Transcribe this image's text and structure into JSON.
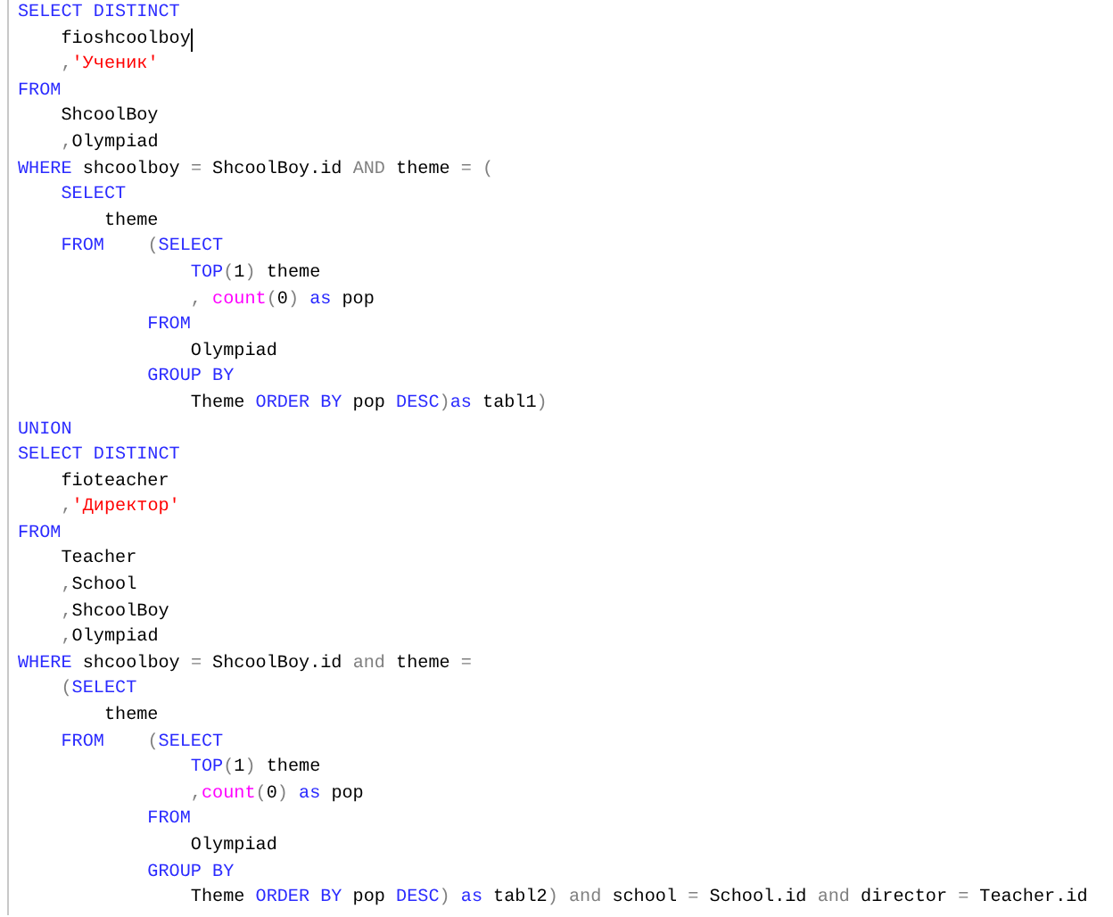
{
  "editor": {
    "lines": [
      {
        "cursor": false,
        "tokens": [
          {
            "kind": "keyword",
            "text": "SELECT DISTINCT"
          }
        ]
      },
      {
        "cursor": true,
        "tokens": [
          {
            "kind": "plain",
            "text": "    fioshcoolboy"
          }
        ]
      },
      {
        "cursor": false,
        "tokens": [
          {
            "kind": "operator",
            "text": "    ,"
          },
          {
            "kind": "string",
            "text": "'Ученик'"
          }
        ]
      },
      {
        "cursor": false,
        "tokens": [
          {
            "kind": "keyword",
            "text": "FROM"
          }
        ]
      },
      {
        "cursor": false,
        "tokens": [
          {
            "kind": "plain",
            "text": "    ShcoolBoy"
          }
        ]
      },
      {
        "cursor": false,
        "tokens": [
          {
            "kind": "operator",
            "text": "    ,"
          },
          {
            "kind": "plain",
            "text": "Olympiad"
          }
        ]
      },
      {
        "cursor": false,
        "tokens": [
          {
            "kind": "keyword",
            "text": "WHERE"
          },
          {
            "kind": "plain",
            "text": " shcoolboy "
          },
          {
            "kind": "operator",
            "text": "="
          },
          {
            "kind": "plain",
            "text": " ShcoolBoy.id "
          },
          {
            "kind": "operator",
            "text": "AND"
          },
          {
            "kind": "plain",
            "text": " theme "
          },
          {
            "kind": "operator",
            "text": "= ("
          }
        ]
      },
      {
        "cursor": false,
        "tokens": [
          {
            "kind": "keyword",
            "text": "    SELECT"
          }
        ]
      },
      {
        "cursor": false,
        "tokens": [
          {
            "kind": "plain",
            "text": "        theme"
          }
        ]
      },
      {
        "cursor": false,
        "tokens": [
          {
            "kind": "keyword",
            "text": "    FROM"
          },
          {
            "kind": "operator",
            "text": "    ("
          },
          {
            "kind": "keyword",
            "text": "SELECT"
          }
        ]
      },
      {
        "cursor": false,
        "tokens": [
          {
            "kind": "keyword",
            "text": "                TOP"
          },
          {
            "kind": "operator",
            "text": "("
          },
          {
            "kind": "plain",
            "text": "1"
          },
          {
            "kind": "operator",
            "text": ")"
          },
          {
            "kind": "plain",
            "text": " theme"
          }
        ]
      },
      {
        "cursor": false,
        "tokens": [
          {
            "kind": "operator",
            "text": "                , "
          },
          {
            "kind": "function",
            "text": "count"
          },
          {
            "kind": "operator",
            "text": "("
          },
          {
            "kind": "plain",
            "text": "0"
          },
          {
            "kind": "operator",
            "text": ")"
          },
          {
            "kind": "keyword",
            "text": " as"
          },
          {
            "kind": "plain",
            "text": " pop"
          }
        ]
      },
      {
        "cursor": false,
        "tokens": [
          {
            "kind": "keyword",
            "text": "            FROM"
          }
        ]
      },
      {
        "cursor": false,
        "tokens": [
          {
            "kind": "plain",
            "text": "                Olympiad"
          }
        ]
      },
      {
        "cursor": false,
        "tokens": [
          {
            "kind": "keyword",
            "text": "            GROUP BY"
          }
        ]
      },
      {
        "cursor": false,
        "tokens": [
          {
            "kind": "plain",
            "text": "                Theme "
          },
          {
            "kind": "keyword",
            "text": "ORDER BY"
          },
          {
            "kind": "plain",
            "text": " pop "
          },
          {
            "kind": "keyword",
            "text": "DESC"
          },
          {
            "kind": "operator",
            "text": ")"
          },
          {
            "kind": "keyword",
            "text": "as"
          },
          {
            "kind": "plain",
            "text": " tabl1"
          },
          {
            "kind": "operator",
            "text": ")"
          }
        ]
      },
      {
        "cursor": false,
        "tokens": [
          {
            "kind": "keyword",
            "text": "UNION"
          }
        ]
      },
      {
        "cursor": false,
        "tokens": [
          {
            "kind": "keyword",
            "text": "SELECT DISTINCT"
          }
        ]
      },
      {
        "cursor": false,
        "tokens": [
          {
            "kind": "plain",
            "text": "    fioteacher"
          }
        ]
      },
      {
        "cursor": false,
        "tokens": [
          {
            "kind": "operator",
            "text": "    ,"
          },
          {
            "kind": "string",
            "text": "'Директор'"
          }
        ]
      },
      {
        "cursor": false,
        "tokens": [
          {
            "kind": "keyword",
            "text": "FROM"
          }
        ]
      },
      {
        "cursor": false,
        "tokens": [
          {
            "kind": "plain",
            "text": "    Teacher"
          }
        ]
      },
      {
        "cursor": false,
        "tokens": [
          {
            "kind": "operator",
            "text": "    ,"
          },
          {
            "kind": "plain",
            "text": "School"
          }
        ]
      },
      {
        "cursor": false,
        "tokens": [
          {
            "kind": "operator",
            "text": "    ,"
          },
          {
            "kind": "plain",
            "text": "ShcoolBoy"
          }
        ]
      },
      {
        "cursor": false,
        "tokens": [
          {
            "kind": "operator",
            "text": "    ,"
          },
          {
            "kind": "plain",
            "text": "Olympiad"
          }
        ]
      },
      {
        "cursor": false,
        "tokens": [
          {
            "kind": "keyword",
            "text": "WHERE"
          },
          {
            "kind": "plain",
            "text": " shcoolboy "
          },
          {
            "kind": "operator",
            "text": "="
          },
          {
            "kind": "plain",
            "text": " ShcoolBoy.id "
          },
          {
            "kind": "operator",
            "text": "and"
          },
          {
            "kind": "plain",
            "text": " theme "
          },
          {
            "kind": "operator",
            "text": "="
          }
        ]
      },
      {
        "cursor": false,
        "tokens": [
          {
            "kind": "operator",
            "text": "    ("
          },
          {
            "kind": "keyword",
            "text": "SELECT"
          }
        ]
      },
      {
        "cursor": false,
        "tokens": [
          {
            "kind": "plain",
            "text": "        theme"
          }
        ]
      },
      {
        "cursor": false,
        "tokens": [
          {
            "kind": "keyword",
            "text": "    FROM"
          },
          {
            "kind": "operator",
            "text": "    ("
          },
          {
            "kind": "keyword",
            "text": "SELECT"
          }
        ]
      },
      {
        "cursor": false,
        "tokens": [
          {
            "kind": "keyword",
            "text": "                TOP"
          },
          {
            "kind": "operator",
            "text": "("
          },
          {
            "kind": "plain",
            "text": "1"
          },
          {
            "kind": "operator",
            "text": ")"
          },
          {
            "kind": "plain",
            "text": " theme"
          }
        ]
      },
      {
        "cursor": false,
        "tokens": [
          {
            "kind": "operator",
            "text": "                ,"
          },
          {
            "kind": "function",
            "text": "count"
          },
          {
            "kind": "operator",
            "text": "("
          },
          {
            "kind": "plain",
            "text": "0"
          },
          {
            "kind": "operator",
            "text": ")"
          },
          {
            "kind": "keyword",
            "text": " as"
          },
          {
            "kind": "plain",
            "text": " pop"
          }
        ]
      },
      {
        "cursor": false,
        "tokens": [
          {
            "kind": "keyword",
            "text": "            FROM"
          }
        ]
      },
      {
        "cursor": false,
        "tokens": [
          {
            "kind": "plain",
            "text": "                Olympiad"
          }
        ]
      },
      {
        "cursor": false,
        "tokens": [
          {
            "kind": "keyword",
            "text": "            GROUP BY"
          }
        ]
      },
      {
        "cursor": false,
        "tokens": [
          {
            "kind": "plain",
            "text": "                Theme "
          },
          {
            "kind": "keyword",
            "text": "ORDER BY"
          },
          {
            "kind": "plain",
            "text": " pop "
          },
          {
            "kind": "keyword",
            "text": "DESC"
          },
          {
            "kind": "operator",
            "text": ")"
          },
          {
            "kind": "keyword",
            "text": " as"
          },
          {
            "kind": "plain",
            "text": " tabl2"
          },
          {
            "kind": "operator",
            "text": ")"
          },
          {
            "kind": "operator",
            "text": " and"
          },
          {
            "kind": "plain",
            "text": " school "
          },
          {
            "kind": "operator",
            "text": "="
          },
          {
            "kind": "plain",
            "text": " School.id "
          },
          {
            "kind": "operator",
            "text": "and"
          },
          {
            "kind": "plain",
            "text": " director "
          },
          {
            "kind": "operator",
            "text": "="
          },
          {
            "kind": "plain",
            "text": " Teacher.id"
          }
        ]
      }
    ]
  }
}
